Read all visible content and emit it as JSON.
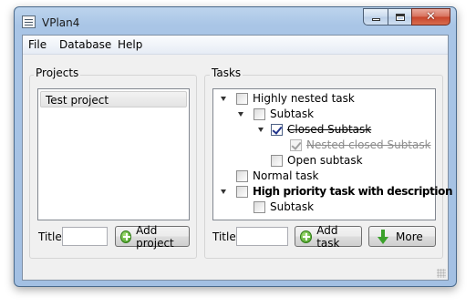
{
  "window": {
    "title": "VPlan4"
  },
  "menu": {
    "items": [
      "File",
      "Database",
      "Help"
    ]
  },
  "projects": {
    "group_title": "Projects",
    "items": [
      "Test project"
    ],
    "title_label": "Title",
    "title_value": "",
    "add_button": "Add project"
  },
  "tasks": {
    "group_title": "Tasks",
    "nodes": [
      {
        "label": "Highly nested task",
        "checked": false,
        "closed": false,
        "bold": false
      },
      {
        "label": "Subtask",
        "checked": false,
        "closed": false,
        "bold": false
      },
      {
        "label": "Closed Subtask",
        "checked": true,
        "closed": true,
        "bold": false
      },
      {
        "label": "Nested closed Subtask",
        "checked": true,
        "closed": true,
        "bold": false
      },
      {
        "label": "Open subtask",
        "checked": false,
        "closed": false,
        "bold": false
      },
      {
        "label": "Normal task",
        "checked": false,
        "closed": false,
        "bold": false
      },
      {
        "label": "High priority task with description",
        "checked": false,
        "closed": false,
        "bold": true
      },
      {
        "label": "Subtask",
        "checked": false,
        "closed": false,
        "bold": false
      }
    ],
    "title_label": "Title",
    "title_value": "",
    "add_button": "Add task",
    "more_button": "More"
  },
  "icons": {
    "add": "plus-circle-icon",
    "more": "down-arrow-icon"
  }
}
